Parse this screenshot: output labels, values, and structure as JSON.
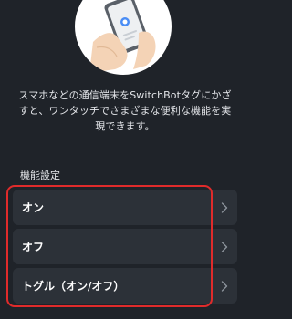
{
  "illustration": {
    "icon": "hand-holding-phone-illustration"
  },
  "description": "スマホなどの通信端末をSwitchBotタグにかざすと、ワンタッチでさまざまな便利な機能を実現できます。",
  "section_title": "機能設定",
  "items": [
    {
      "label": "オン",
      "icon": "chevron-right-icon"
    },
    {
      "label": "オフ",
      "icon": "chevron-right-icon"
    },
    {
      "label": "トグル（オン/オフ）",
      "icon": "chevron-right-icon"
    }
  ],
  "colors": {
    "background": "#1f2329",
    "card": "#2c3138",
    "text": "#e4e6ea",
    "highlight": "#e02b2b"
  }
}
